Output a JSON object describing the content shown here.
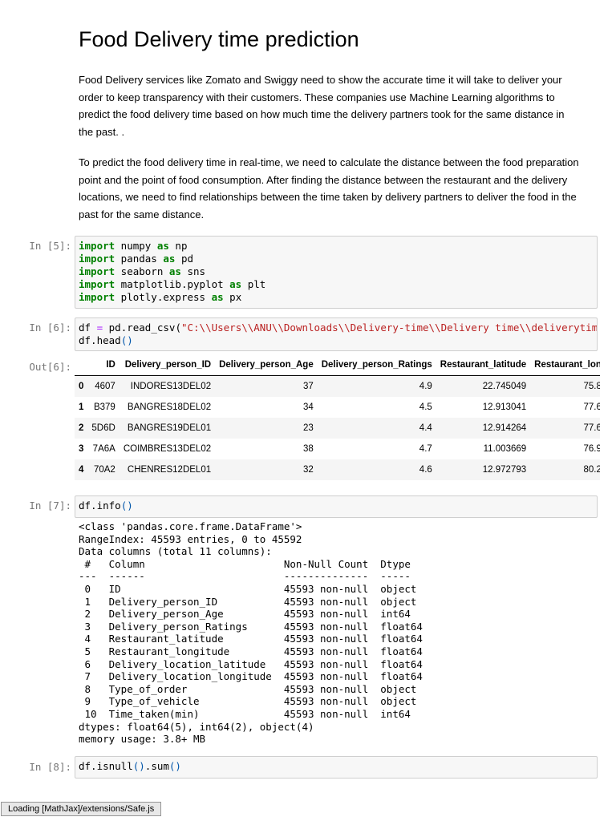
{
  "markdown": {
    "title": "Food Delivery time prediction",
    "para1": "Food Delivery services like Zomato and Swiggy need to show the accurate time it will take to deliver your order to keep transparency with their customers. These companies use Machine Learning algorithms to predict the food delivery time based on how much time the delivery partners took for the same distance in the past. .",
    "para2": "To predict the food delivery time in real-time, we need to calculate the distance between the food preparation point and the point of food consumption. After finding the distance between the restaurant and the delivery locations, we need to find relationships between the time taken by delivery partners to deliver the food in the past for the same distance."
  },
  "cells": [
    {
      "prompt": "In [5]:"
    },
    {
      "prompt": "In [6]:",
      "out_prompt": "Out[6]:"
    },
    {
      "prompt": "In [7]:"
    },
    {
      "prompt": "In [8]:"
    }
  ],
  "cell5_code": [
    {
      "kw": "import",
      "mod": " numpy ",
      "as": "as",
      "alias": " np"
    },
    {
      "kw": "import",
      "mod": " pandas ",
      "as": "as",
      "alias": " pd"
    },
    {
      "kw": "import",
      "mod": " seaborn ",
      "as": "as",
      "alias": " sns"
    },
    {
      "kw": "import",
      "mod": " matplotlib.pyplot ",
      "as": "as",
      "alias": " plt"
    },
    {
      "kw": "import",
      "mod": " plotly.express ",
      "as": "as",
      "alias": " px"
    }
  ],
  "cell6_code": {
    "var": "df",
    "op": "=",
    "call": "pd.read_csv(",
    "path": "\"C:\\\\Users\\\\ANU\\\\Downloads\\\\Delivery-time\\\\Delivery time\\\\deliverytime.",
    "line2_obj": "df.head",
    "line2_paren": "()"
  },
  "dataframe": {
    "columns": [
      "",
      "ID",
      "Delivery_person_ID",
      "Delivery_person_Age",
      "Delivery_person_Ratings",
      "Restaurant_latitude",
      "Restaurant_lon"
    ],
    "rows": [
      [
        "0",
        "4607",
        "INDORES13DEL02",
        "37",
        "4.9",
        "22.745049",
        "75.8"
      ],
      [
        "1",
        "B379",
        "BANGRES18DEL02",
        "34",
        "4.5",
        "12.913041",
        "77.6"
      ],
      [
        "2",
        "5D6D",
        "BANGRES19DEL01",
        "23",
        "4.4",
        "12.914264",
        "77.6"
      ],
      [
        "3",
        "7A6A",
        "COIMBRES13DEL02",
        "38",
        "4.7",
        "11.003669",
        "76.9"
      ],
      [
        "4",
        "70A2",
        "CHENRES12DEL01",
        "32",
        "4.6",
        "12.972793",
        "80.2"
      ]
    ]
  },
  "cell7_code": {
    "obj": "df.info",
    "paren": "()"
  },
  "cell7_output": "<class 'pandas.core.frame.DataFrame'>\nRangeIndex: 45593 entries, 0 to 45592\nData columns (total 11 columns):\n #   Column                       Non-Null Count  Dtype  \n---  ------                       --------------  -----  \n 0   ID                           45593 non-null  object \n 1   Delivery_person_ID           45593 non-null  object \n 2   Delivery_person_Age          45593 non-null  int64  \n 3   Delivery_person_Ratings      45593 non-null  float64\n 4   Restaurant_latitude          45593 non-null  float64\n 5   Restaurant_longitude         45593 non-null  float64\n 6   Delivery_location_latitude   45593 non-null  float64\n 7   Delivery_location_longitude  45593 non-null  float64\n 8   Type_of_order                45593 non-null  object \n 9   Type_of_vehicle              45593 non-null  object \n 10  Time_taken(min)              45593 non-null  int64  \ndtypes: float64(5), int64(2), object(4)\nmemory usage: 3.8+ MB",
  "cell8_code": {
    "obj": "df.isnull",
    "p1": "()",
    "dot": ".sum",
    "p2": "()"
  },
  "status_bar": "Loading [MathJax]/extensions/Safe.js",
  "colors": {
    "keyword": "#008000",
    "string": "#ba2121",
    "operator": "#aa22ff",
    "paren": "#0055aa",
    "prompt": "#777777"
  }
}
